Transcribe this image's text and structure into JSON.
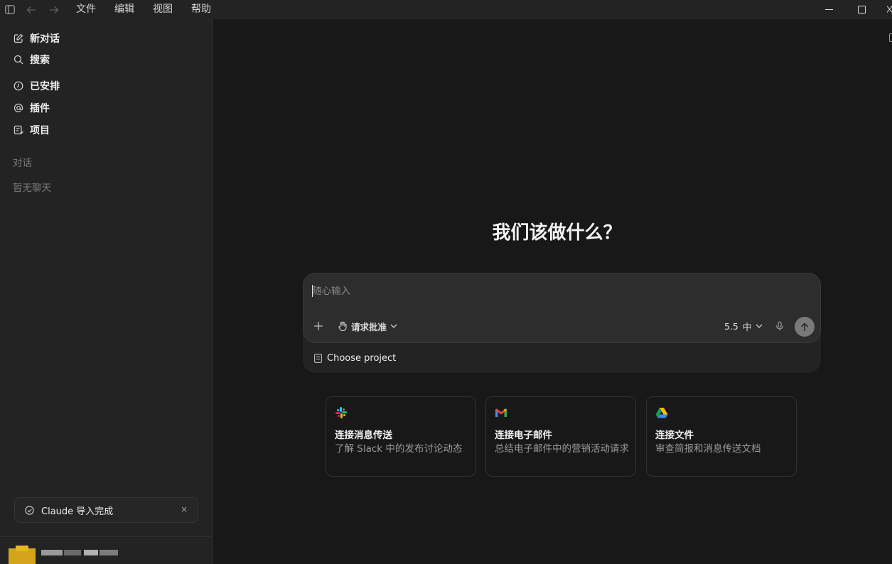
{
  "titlebar": {
    "menu": [
      "文件",
      "编辑",
      "视图",
      "帮助"
    ]
  },
  "sidebar": {
    "nav": [
      {
        "label": "新对话",
        "icon": "edit-icon"
      },
      {
        "label": "搜索",
        "icon": "search-icon"
      },
      {
        "label": "已安排",
        "icon": "clock-icon"
      },
      {
        "label": "插件",
        "icon": "at-icon"
      },
      {
        "label": "项目",
        "icon": "project-icon"
      }
    ],
    "section_title": "对话",
    "empty_text": "暂无聊天",
    "toast": {
      "text": "Claude 导入完成",
      "close": "×"
    }
  },
  "main": {
    "headline": "我们该做什么？",
    "composer": {
      "placeholder": "随心输入",
      "approve_label": "请求批准",
      "model_version": "5.5",
      "model_level": "中",
      "project_label": "Choose project"
    },
    "cards": [
      {
        "title": "连接消息传送",
        "desc": "了解 Slack 中的发布讨论动态",
        "icon": "slack-icon"
      },
      {
        "title": "连接电子邮件",
        "desc": "总结电子邮件中的营销活动请求",
        "icon": "gmail-icon"
      },
      {
        "title": "连接文件",
        "desc": "审查简报和消息传送文档",
        "icon": "drive-icon"
      }
    ]
  },
  "colors": {
    "background": "#181818",
    "sidebar": "#232323",
    "composer": "#2d2d2d",
    "send_button": "#7a7a7a"
  }
}
